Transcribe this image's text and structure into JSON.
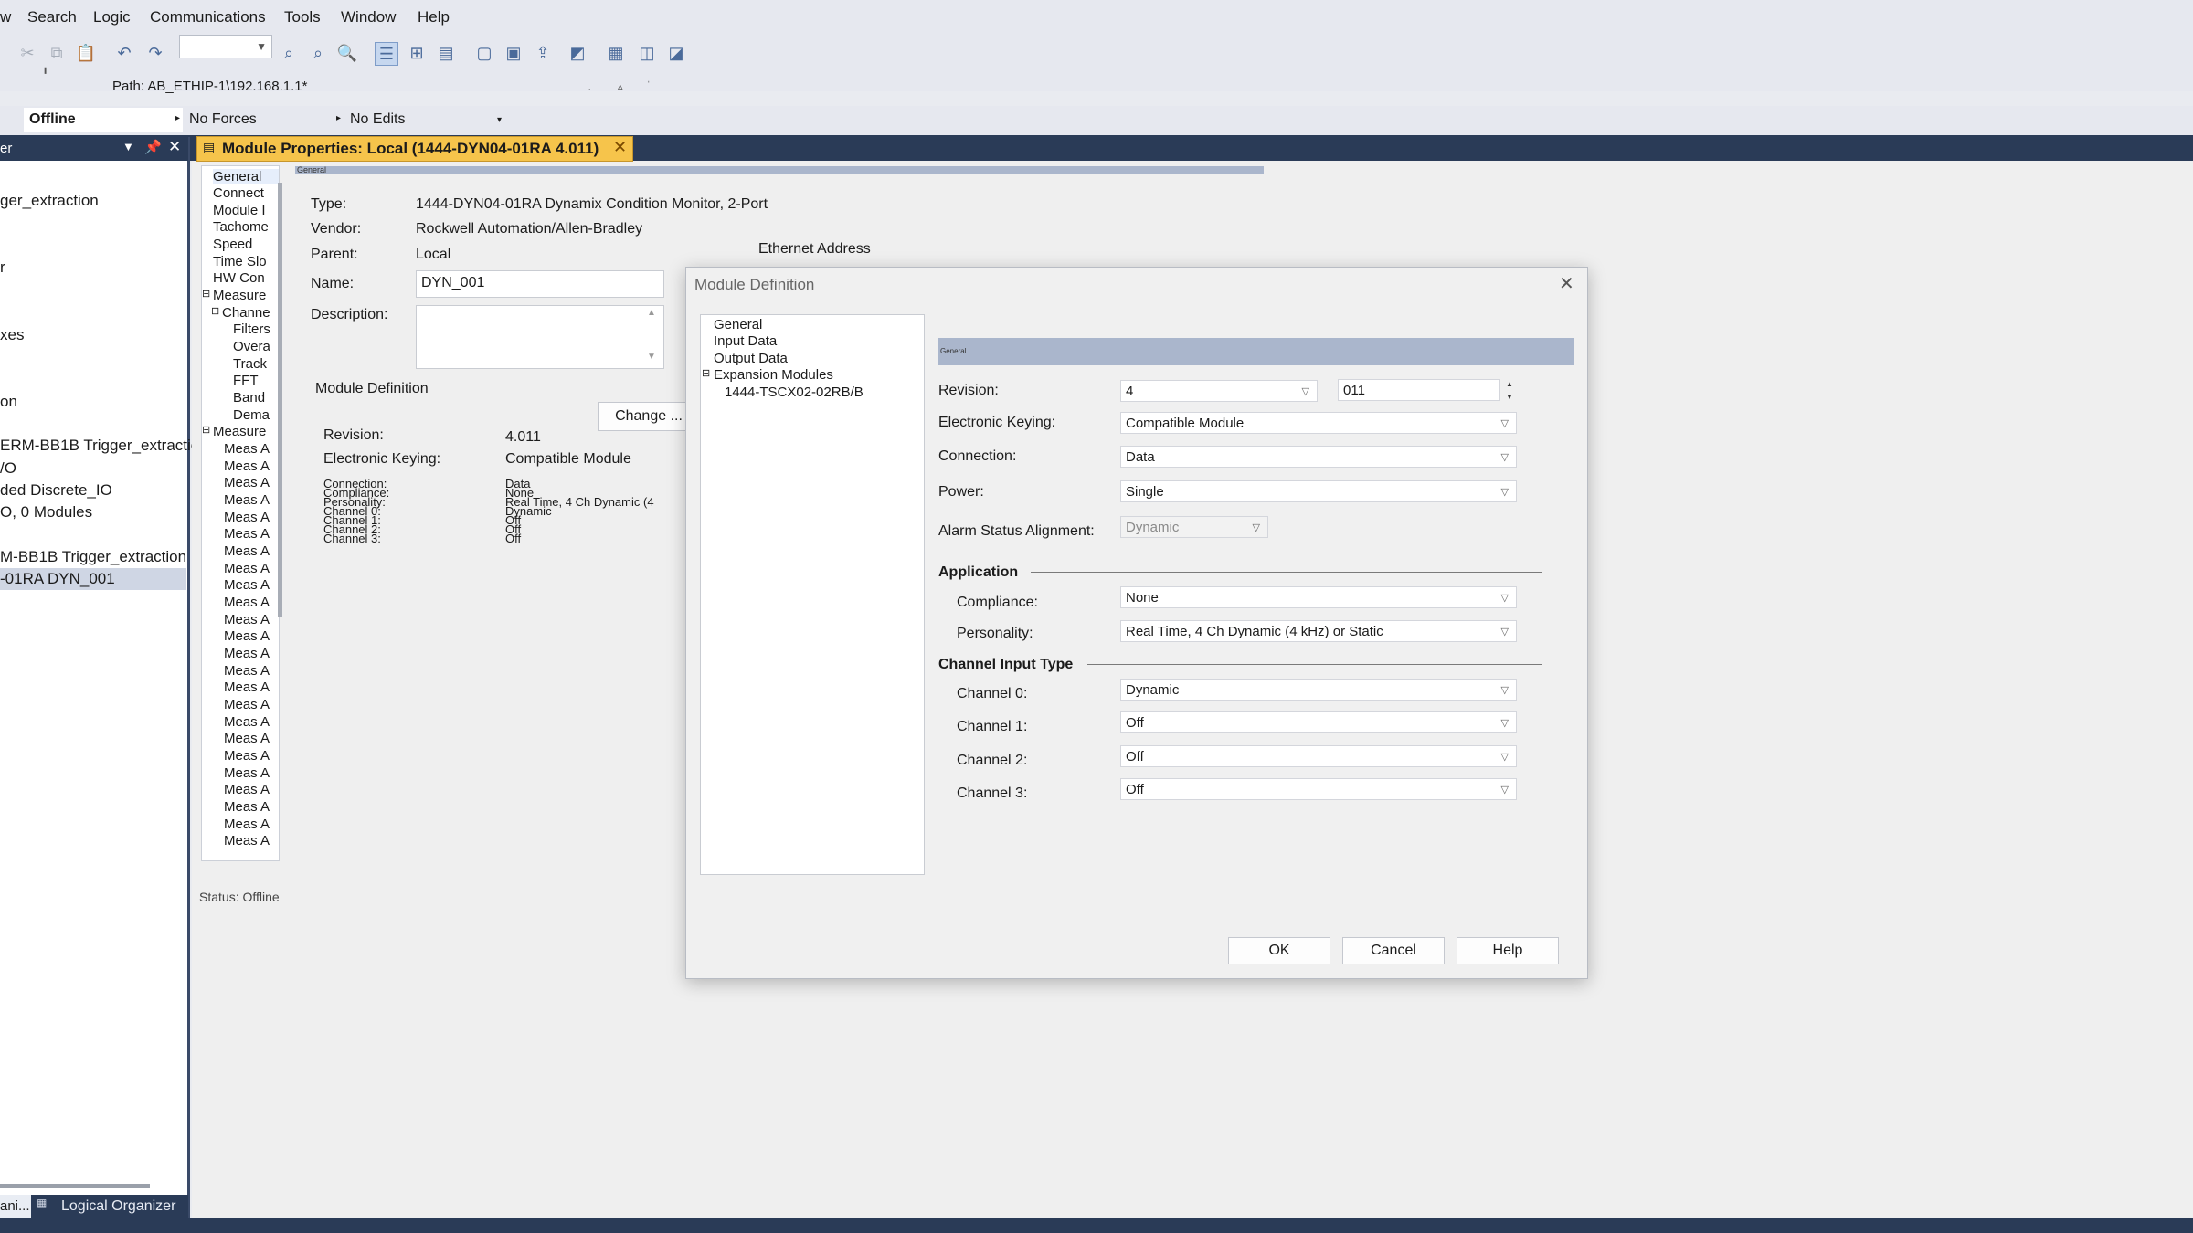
{
  "menu": [
    "w",
    "Search",
    "Logic",
    "Communications",
    "Tools",
    "Window",
    "Help"
  ],
  "toolbar": {
    "path_label": "Path: AB_ETHIP-1\\192.168.1.1*"
  },
  "status": {
    "mode": "Offline",
    "forces": "No Forces",
    "edits": "No Edits"
  },
  "left_panel": {
    "title": "er",
    "items": [
      "ger_extraction",
      "r",
      "xes",
      "on",
      "ERM-BB1B Trigger_extractio",
      "/O",
      "ded Discrete_IO",
      "O, 0 Modules",
      "M-BB1B Trigger_extraction",
      "-01RA DYN_001"
    ],
    "bottom_tabs": [
      "ani...",
      "Logical Organizer"
    ]
  },
  "module_tab": {
    "title": "Module Properties: Local (1444-DYN04-01RA 4.011)"
  },
  "nav": {
    "items": [
      "General",
      "Connect",
      "Module I",
      "Tachome",
      "Speed",
      "Time Slo",
      "HW Con",
      "Measure",
      "Channe",
      "Filters",
      "Overa",
      "Track",
      "FFT",
      "Band",
      "Dema",
      "Measure"
    ],
    "meas_label": "Meas A",
    "status_text": "Status: Offline"
  },
  "general": {
    "header_strip": "General",
    "type_label": "Type:",
    "type_value": "1444-DYN04-01RA Dynamix Condition Monitor, 2-Port",
    "vendor_label": "Vendor:",
    "vendor_value": "Rockwell Automation/Allen-Bradley",
    "parent_label": "Parent:",
    "parent_value": "Local",
    "name_label": "Name:",
    "name_value": "DYN_001",
    "description_label": "Description:",
    "ethernet_label": "Ethernet Address",
    "module_def_title": "Module Definition",
    "change_button": "Change ...",
    "md_revision_label": "Revision:",
    "md_revision_value": "4.011",
    "md_keying_label": "Electronic Keying:",
    "md_keying_value": "Compatible Module",
    "md_small_labels": [
      "Connection:",
      "Compliance:",
      "Personality:",
      "Channel 0:",
      "Channel 1:",
      "Channel 2:",
      "Channel 3:"
    ],
    "md_small_values": [
      "Data",
      "None",
      "Real Time, 4 Ch Dynamic (4",
      "Dynamic",
      "Off",
      "Off",
      "Off"
    ]
  },
  "dialog": {
    "title": "Module Definition",
    "tree": [
      "General",
      "Input Data",
      "Output Data",
      "Expansion Modules",
      "1444-TSCX02-02RB/B"
    ],
    "banner": "General",
    "revision_label": "Revision:",
    "revision_major": "4",
    "revision_minor": "011",
    "keying_label": "Electronic Keying:",
    "keying_value": "Compatible Module",
    "connection_label": "Connection:",
    "connection_value": "Data",
    "power_label": "Power:",
    "power_value": "Single",
    "alarm_label": "Alarm Status Alignment:",
    "alarm_value": "Dynamic",
    "application_title": "Application",
    "compliance_label": "Compliance:",
    "compliance_value": "None",
    "personality_label": "Personality:",
    "personality_value": "Real Time, 4 Ch Dynamic (4 kHz) or Static",
    "channel_title": "Channel Input Type",
    "ch0_label": "Channel 0:",
    "ch0_value": "Dynamic",
    "ch1_label": "Channel 1:",
    "ch1_value": "Off",
    "ch2_label": "Channel 2:",
    "ch2_value": "Off",
    "ch3_label": "Channel 3:",
    "ch3_value": "Off",
    "ok": "OK",
    "cancel": "Cancel",
    "help": "Help"
  }
}
